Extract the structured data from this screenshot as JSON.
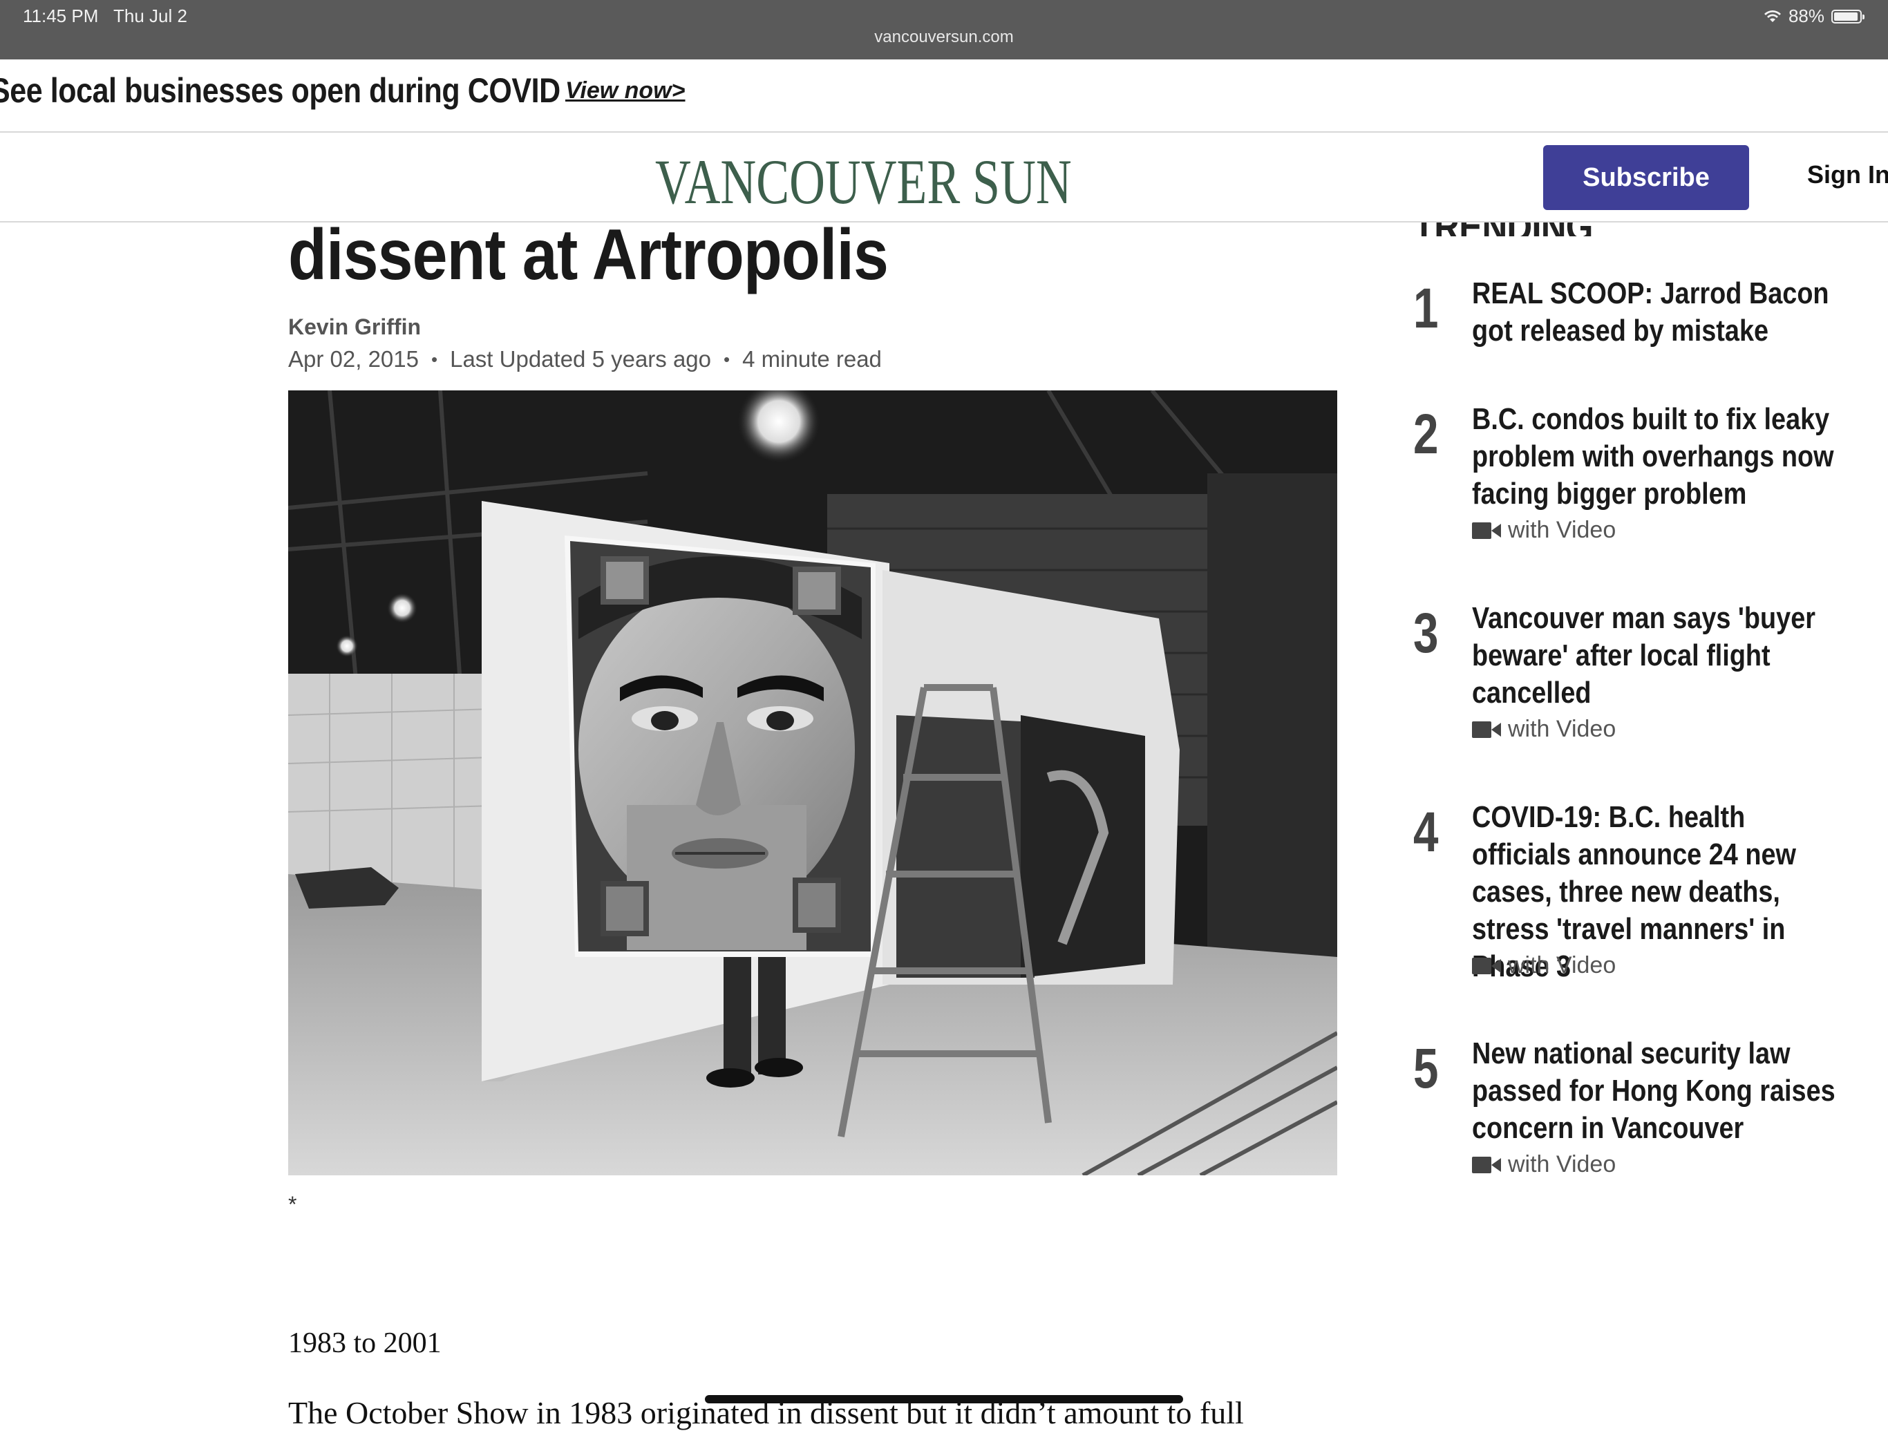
{
  "status_bar": {
    "time": "11:45 PM",
    "date": "Thu Jul 2",
    "battery": "88%",
    "url": "vancouversun.com"
  },
  "promo": {
    "text": "See local businesses open during COVID",
    "link": "View now>"
  },
  "header": {
    "logo": "VANCOUVER SUN",
    "subscribe": "Subscribe",
    "sign_in": "Sign In"
  },
  "article": {
    "headline": "dissent at Artropolis",
    "author": "Kevin Griffin",
    "date": "Apr 02, 2015",
    "updated": "Last Updated 5 years ago",
    "read_time": "4 minute read",
    "caption": "*",
    "body_p1": "1983 to 2001",
    "body_p2": "The October Show in 1983 originated in dissent but it didn’t amount to full"
  },
  "trending": {
    "label": "TRENDING",
    "items": [
      {
        "rank": "1",
        "title": "REAL SCOOP: Jarrod Bacon got released by mistake",
        "video": ""
      },
      {
        "rank": "2",
        "title": "B.C. condos built to fix leaky problem with overhangs now facing bigger problem",
        "video": "with Video"
      },
      {
        "rank": "3",
        "title": "Vancouver man says 'buyer beware' after local flight cancelled",
        "video": "with Video"
      },
      {
        "rank": "4",
        "title": "COVID-19: B.C. health officials announce 24 new cases, three new deaths, stress 'travel manners' in Phase 3",
        "video": "with Video"
      },
      {
        "rank": "5",
        "title": "New national security law passed for Hong Kong raises concern in Vancouver",
        "video": "with Video"
      }
    ]
  },
  "colors": {
    "status_bar_bg": "#5a5a5a",
    "logo": "#3d5f4c",
    "subscribe_bg": "#3f3f97"
  }
}
